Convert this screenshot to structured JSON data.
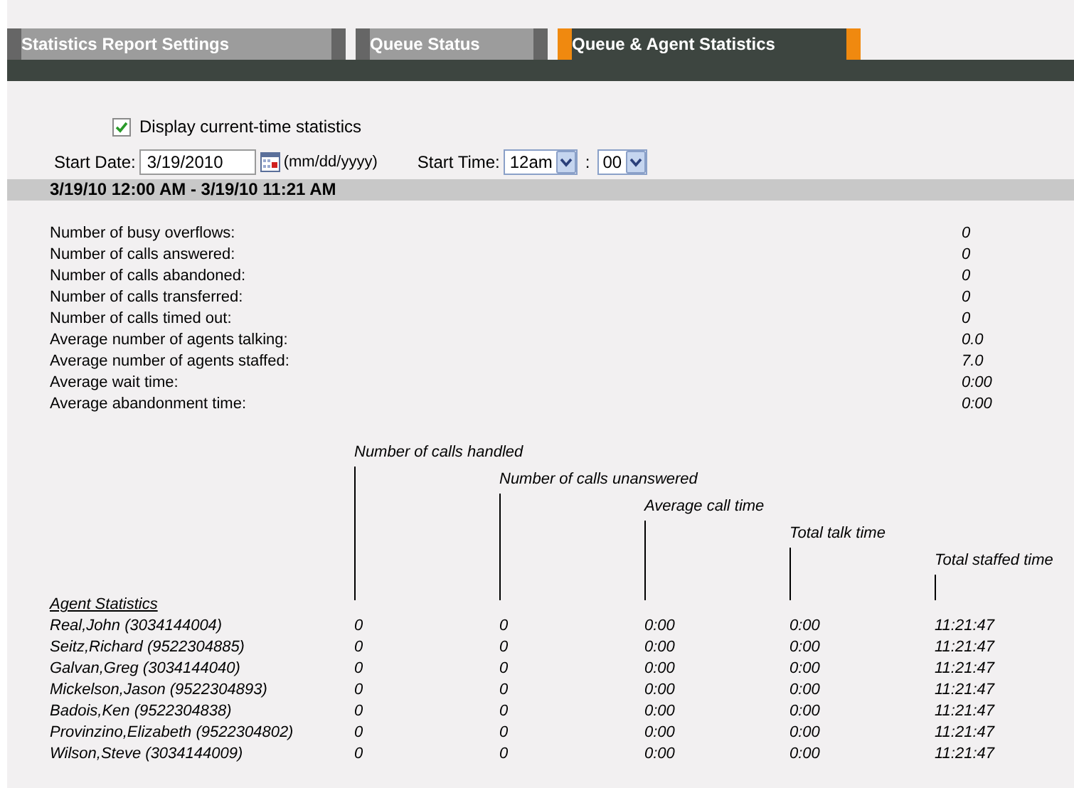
{
  "tabs": [
    {
      "label": "Statistics Report Settings",
      "selected": false
    },
    {
      "label": "Queue Status",
      "selected": false
    },
    {
      "label": "Queue & Agent Statistics",
      "selected": true
    }
  ],
  "display_current_time": {
    "label": "Display current-time statistics",
    "checked": true
  },
  "start_date": {
    "label": "Start Date:",
    "value": "3/19/2010",
    "format_hint": "(mm/dd/yyyy)"
  },
  "start_time": {
    "label": "Start Time:",
    "hour": "12am",
    "separator": ":",
    "minute": "00"
  },
  "range_header": "3/19/10 12:00 AM - 3/19/10 11:21 AM",
  "summary": [
    {
      "label": "Number of busy overflows:",
      "value": "0"
    },
    {
      "label": "Number of calls answered:",
      "value": "0"
    },
    {
      "label": "Number of calls abandoned:",
      "value": "0"
    },
    {
      "label": "Number of calls transferred:",
      "value": "0"
    },
    {
      "label": "Number of calls timed out:",
      "value": "0"
    },
    {
      "label": "Average number of agents talking:",
      "value": "0.0"
    },
    {
      "label": "Average number of agents staffed:",
      "value": "7.0"
    },
    {
      "label": "Average wait time:",
      "value": "0:00"
    },
    {
      "label": "Average abandonment time:",
      "value": "0:00"
    }
  ],
  "agent_table": {
    "title": "Agent Statistics",
    "columns": [
      "Number of calls handled",
      "Number of calls unanswered",
      "Average call time",
      "Total talk time",
      "Total staffed time"
    ],
    "rows": [
      {
        "agent": "Real,John (3034144004)",
        "values": [
          "0",
          "0",
          "0:00",
          "0:00",
          "11:21:47"
        ]
      },
      {
        "agent": "Seitz,Richard (9522304885)",
        "values": [
          "0",
          "0",
          "0:00",
          "0:00",
          "11:21:47"
        ]
      },
      {
        "agent": "Galvan,Greg (3034144040)",
        "values": [
          "0",
          "0",
          "0:00",
          "0:00",
          "11:21:47"
        ]
      },
      {
        "agent": "Mickelson,Jason (9522304893)",
        "values": [
          "0",
          "0",
          "0:00",
          "0:00",
          "11:21:47"
        ]
      },
      {
        "agent": "Badois,Ken (9522304838)",
        "values": [
          "0",
          "0",
          "0:00",
          "0:00",
          "11:21:47"
        ]
      },
      {
        "agent": "Provinzino,Elizabeth (9522304802)",
        "values": [
          "0",
          "0",
          "0:00",
          "0:00",
          "11:21:47"
        ]
      },
      {
        "agent": "Wilson,Steve (3034144009)",
        "values": [
          "0",
          "0",
          "0:00",
          "0:00",
          "11:21:47"
        ]
      }
    ]
  }
}
